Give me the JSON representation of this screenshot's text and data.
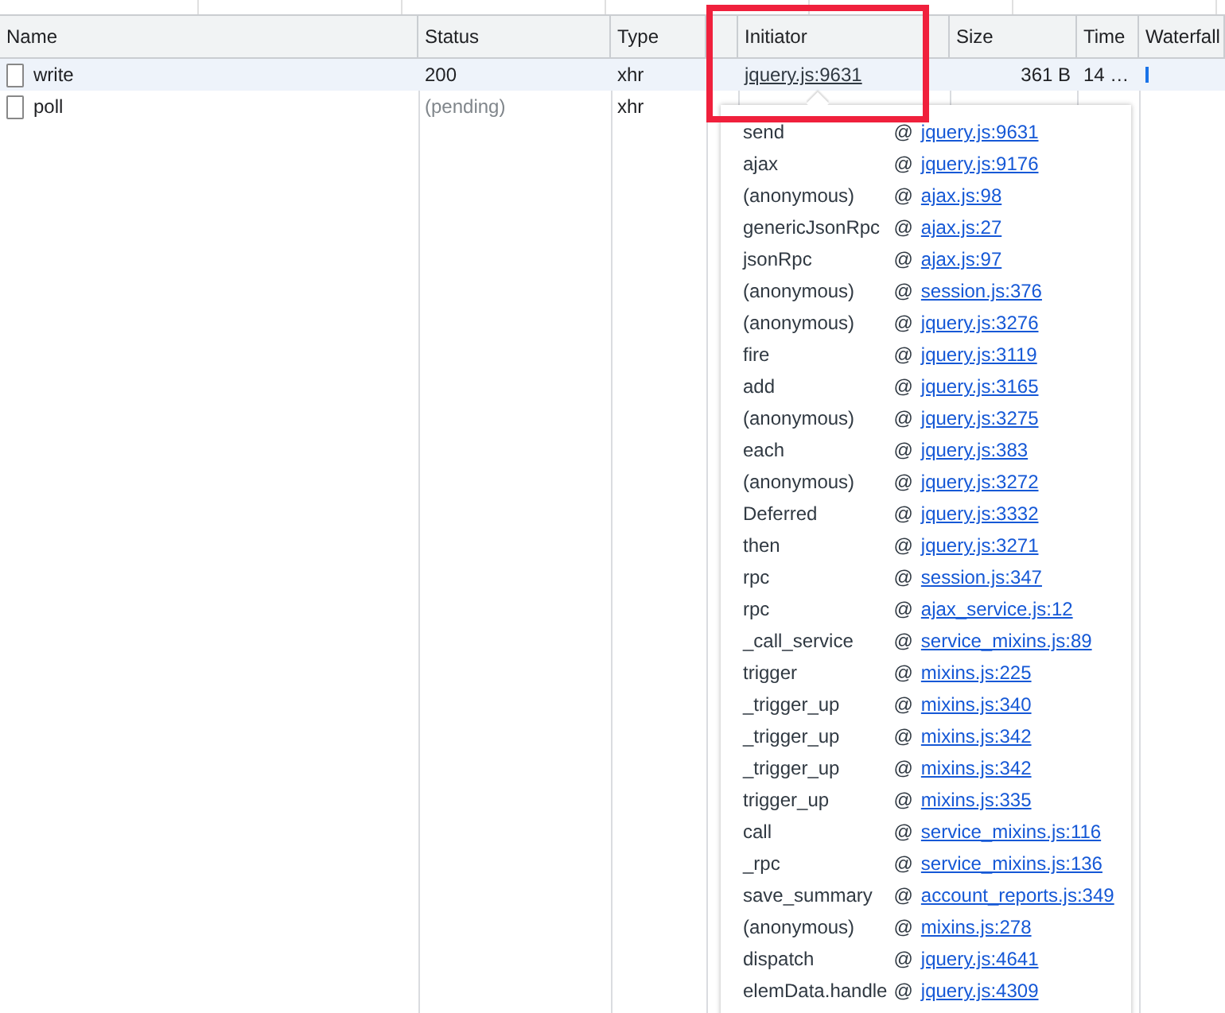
{
  "columns": [
    "Name",
    "Status",
    "Type",
    "",
    "Initiator",
    "Size",
    "Time",
    "Waterfall"
  ],
  "requests": [
    {
      "name": "write",
      "status": "200",
      "pending": false,
      "type": "xhr",
      "initiator": "jquery.js:9631",
      "size": "361 B",
      "time": "14 …",
      "selected": true,
      "waterfall": true
    },
    {
      "name": "poll",
      "status": "(pending)",
      "pending": true,
      "type": "xhr",
      "selected": false,
      "waterfall": false
    }
  ],
  "call_stack": [
    {
      "function": "send",
      "link": "jquery.js:9631"
    },
    {
      "function": "ajax",
      "link": "jquery.js:9176"
    },
    {
      "function": "(anonymous)",
      "link": "ajax.js:98"
    },
    {
      "function": "genericJsonRpc",
      "link": "ajax.js:27"
    },
    {
      "function": "jsonRpc",
      "link": "ajax.js:97"
    },
    {
      "function": "(anonymous)",
      "link": "session.js:376"
    },
    {
      "function": "(anonymous)",
      "link": "jquery.js:3276"
    },
    {
      "function": "fire",
      "link": "jquery.js:3119"
    },
    {
      "function": "add",
      "link": "jquery.js:3165"
    },
    {
      "function": "(anonymous)",
      "link": "jquery.js:3275"
    },
    {
      "function": "each",
      "link": "jquery.js:383"
    },
    {
      "function": "(anonymous)",
      "link": "jquery.js:3272"
    },
    {
      "function": "Deferred",
      "link": "jquery.js:3332"
    },
    {
      "function": "then",
      "link": "jquery.js:3271"
    },
    {
      "function": "rpc",
      "link": "session.js:347"
    },
    {
      "function": "rpc",
      "link": "ajax_service.js:12"
    },
    {
      "function": "_call_service",
      "link": "service_mixins.js:89"
    },
    {
      "function": "trigger",
      "link": "mixins.js:225"
    },
    {
      "function": "_trigger_up",
      "link": "mixins.js:340"
    },
    {
      "function": "_trigger_up",
      "link": "mixins.js:342"
    },
    {
      "function": "_trigger_up",
      "link": "mixins.js:342"
    },
    {
      "function": "trigger_up",
      "link": "mixins.js:335"
    },
    {
      "function": "call",
      "link": "service_mixins.js:116"
    },
    {
      "function": "_rpc",
      "link": "service_mixins.js:136"
    },
    {
      "function": "save_summary",
      "link": "account_reports.js:349"
    },
    {
      "function": "(anonymous)",
      "link": "mixins.js:278"
    },
    {
      "function": "dispatch",
      "link": "jquery.js:4641"
    },
    {
      "function": "elemData.handle",
      "link": "jquery.js:4309"
    }
  ],
  "at_sign": "@",
  "highlight": true
}
